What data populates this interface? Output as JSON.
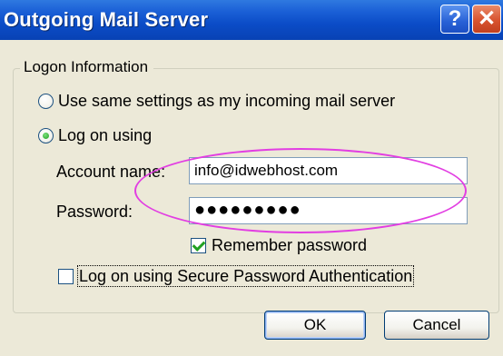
{
  "window": {
    "title": "Outgoing Mail Server",
    "help_glyph": "?",
    "close_glyph": "✕"
  },
  "logon": {
    "group_label": "Logon Information",
    "radio_same": {
      "label": "Use same settings as my incoming mail server",
      "checked": false
    },
    "radio_log_on": {
      "label": "Log on using",
      "checked": true
    },
    "account_label": "Account name:",
    "account_value": "info@idwebhost.com",
    "password_label": "Password:",
    "password_value": "●●●●●●●●●",
    "remember": {
      "label": "Remember password",
      "checked": true
    },
    "spa": {
      "label": "Log on using Secure Password Authentication",
      "checked": false
    }
  },
  "buttons": {
    "ok_label": "OK",
    "cancel_label": "Cancel"
  },
  "annotation": {
    "color": "#e23ee2",
    "shape": "ellipse"
  }
}
